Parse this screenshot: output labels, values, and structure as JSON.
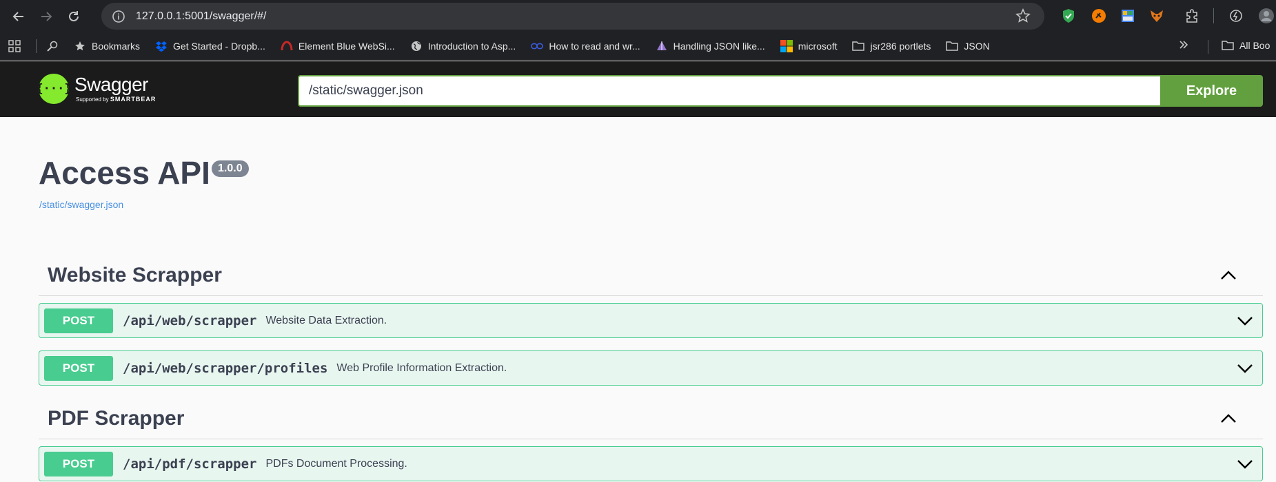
{
  "browser": {
    "url": "127.0.0.1:5001/swagger/#/",
    "bookmarks": [
      {
        "label": "Bookmarks",
        "icon": "star-icon"
      },
      {
        "label": "Get Started - Dropb...",
        "icon": "dropbox-icon"
      },
      {
        "label": "Element Blue WebSi...",
        "icon": "element-icon"
      },
      {
        "label": "Introduction to Asp...",
        "icon": "globe-icon"
      },
      {
        "label": "How to read and wr...",
        "icon": "link-icon"
      },
      {
        "label": "Handling JSON like...",
        "icon": "prism-icon"
      },
      {
        "label": "microsoft",
        "icon": "microsoft-icon"
      },
      {
        "label": "jsr286 portlets",
        "icon": "folder-icon"
      },
      {
        "label": "JSON",
        "icon": "folder-icon"
      }
    ],
    "all_bookmarks": "All Boo"
  },
  "topbar": {
    "logo_text": "Swagger",
    "logo_sub_prefix": "Supported by",
    "logo_sub_brand": "SMARTBEAR",
    "spec_url": "/static/swagger.json",
    "explore_label": "Explore"
  },
  "info": {
    "title": "Access API",
    "version": "1.0.0",
    "spec_link": "/static/swagger.json"
  },
  "tags": [
    {
      "name": "Website Scrapper",
      "operations": [
        {
          "method": "POST",
          "path": "/api/web/scrapper",
          "summary": "Website Data Extraction."
        },
        {
          "method": "POST",
          "path": "/api/web/scrapper/profiles",
          "summary": "Web Profile Information Extraction."
        }
      ]
    },
    {
      "name": "PDF Scrapper",
      "operations": [
        {
          "method": "POST",
          "path": "/api/pdf/scrapper",
          "summary": "PDFs Document Processing."
        }
      ]
    }
  ],
  "colors": {
    "post": "#49cc90",
    "post_bg": "#e8f6f0",
    "topbar": "#1b1b1b",
    "explore": "#62a03f",
    "logo": "#85ea2d"
  }
}
